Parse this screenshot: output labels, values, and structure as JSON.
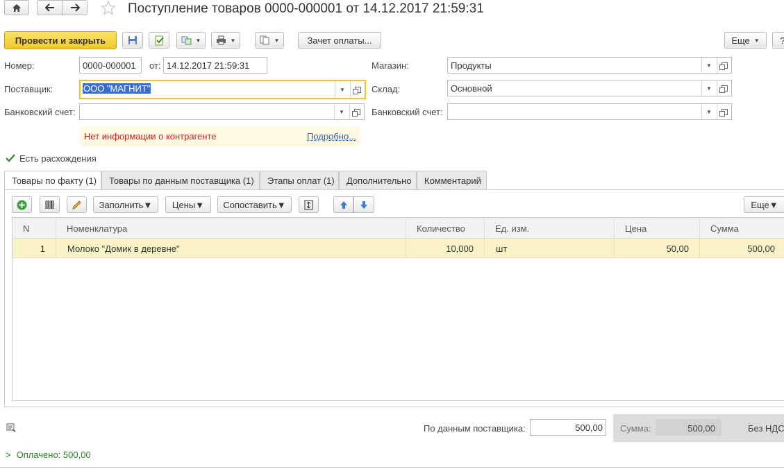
{
  "window": {
    "title": "Поступление товаров 0000-000001 от 14.12.2017 21:59:31"
  },
  "toolbar": {
    "post_close_label": "Провести и закрыть",
    "zachet_label": "Зачет оплаты...",
    "more_label": "Еще",
    "help_label": "?"
  },
  "form": {
    "number_label": "Номер:",
    "number_value": "0000-000001",
    "from_label": "от:",
    "date_value": "14.12.2017 21:59:31",
    "supplier_label": "Поставщик:",
    "supplier_value": "ООО \"МАГНИТ\"",
    "bank_label_left": "Банковский счет:",
    "bank_value_left": "",
    "store_label": "Магазин:",
    "store_value": "Продукты",
    "warehouse_label": "Склад:",
    "warehouse_value": "Основной",
    "bank_label_right": "Банковский счет:",
    "bank_value_right": "",
    "warning_text": "Нет информации о контрагенте",
    "warning_link": "Подробно...",
    "discrepancy_label": "Есть расхождения",
    "discrepancy_checked": true
  },
  "tabs": [
    {
      "label": "Товары по факту (1)",
      "active": true
    },
    {
      "label": "Товары по данным поставщика (1)",
      "active": false
    },
    {
      "label": "Этапы оплат (1)",
      "active": false
    },
    {
      "label": "Дополнительно",
      "active": false
    },
    {
      "label": "Комментарий",
      "active": false
    }
  ],
  "table_toolbar": {
    "fill_label": "Заполнить",
    "prices_label": "Цены",
    "compare_label": "Сопоставить",
    "more_label": "Еще"
  },
  "table": {
    "columns": [
      "N",
      "Номенклатура",
      "Количество",
      "Ед. изм.",
      "Цена",
      "Сумма"
    ],
    "rows": [
      {
        "n": "1",
        "item": "Молоко \"Домик в деревне\"",
        "qty": "10,000",
        "unit": "шт",
        "price": "50,00",
        "sum": "500,00"
      }
    ]
  },
  "footer": {
    "supplier_data_label": "По данным поставщика:",
    "supplier_data_value": "500,00",
    "sum_label": "Сумма:",
    "sum_value": "500,00",
    "vat_label": "Без НДС",
    "paid_label": "Оплачено: 500,00"
  },
  "colors": {
    "primary_button": "#f5d230",
    "warning_text": "#cc2222",
    "warning_bg": "#fdf9e2",
    "selected_row": "#fbf3c8",
    "link": "#3a5d9c",
    "paid_text": "#2a7a2a"
  }
}
